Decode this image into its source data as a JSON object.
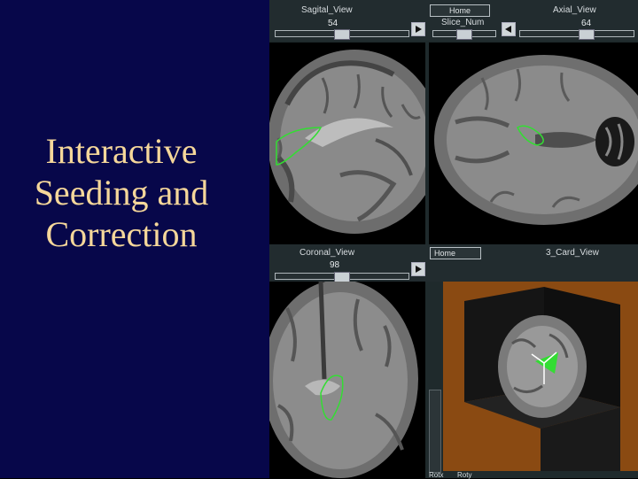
{
  "slide": {
    "title_lines": [
      "Interactive",
      "Seeding and",
      "Correction"
    ]
  },
  "toolbar_top": {
    "sagittal_label": "Sagital_View",
    "sagittal_value": "54",
    "home_label": "Home",
    "slice_num_label": "Slice_Num",
    "axial_label": "Axial_View",
    "axial_value": "64"
  },
  "toolbar_middle": {
    "coronal_label": "Coronal_View",
    "coronal_value": "98",
    "home_label": "Home",
    "d3_label": "3_Card_View"
  },
  "bottom_labels": {
    "rotx_label": "Rotx",
    "roty_label": "Roty"
  },
  "sliders": {
    "sagittal": 0.49,
    "slice_num": 0.5,
    "axial": 0.6,
    "coronal": 0.49
  },
  "colors": {
    "slide_background": "#07074a",
    "title_text": "#f5d79a",
    "segmentation_outline": "#33dd33",
    "render_background": "#8a4a12"
  }
}
